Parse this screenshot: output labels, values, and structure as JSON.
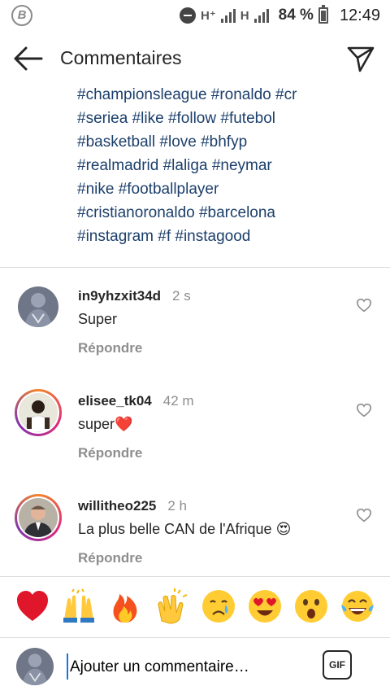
{
  "status_bar": {
    "carrier_icon": "B",
    "network1": "H⁺",
    "network2": "H",
    "battery": "84 %",
    "time": "12:49"
  },
  "header": {
    "title": "Commentaires"
  },
  "caption": {
    "lines": [
      "#championsleague #ronaldo #cr",
      "#seriea #like #follow #futebol",
      "#basketball #love #bhfyp",
      "#realmadrid #laliga #neymar",
      "#nike #footballplayer",
      "#cristianoronaldo #barcelona",
      "#instagram #f #instagood"
    ]
  },
  "comments": [
    {
      "username": "in9yhzxit34d",
      "time": "2 s",
      "text": "Super",
      "reply": "Répondre"
    },
    {
      "username": "elisee_tk04",
      "time": "42 m",
      "text": "super❤️",
      "reply": "Répondre"
    },
    {
      "username": "willitheo225",
      "time": "2 h",
      "text": "La plus belle CAN de l'Afrique 😍",
      "reply": "Répondre"
    }
  ],
  "emoji_bar": [
    "red-heart",
    "raising-hands",
    "fire",
    "clapping-hands",
    "crying-face",
    "heart-eyes",
    "astonished",
    "tears-of-joy"
  ],
  "composer": {
    "placeholder": "Ajouter un commentaire…",
    "gif_label": "GIF"
  }
}
